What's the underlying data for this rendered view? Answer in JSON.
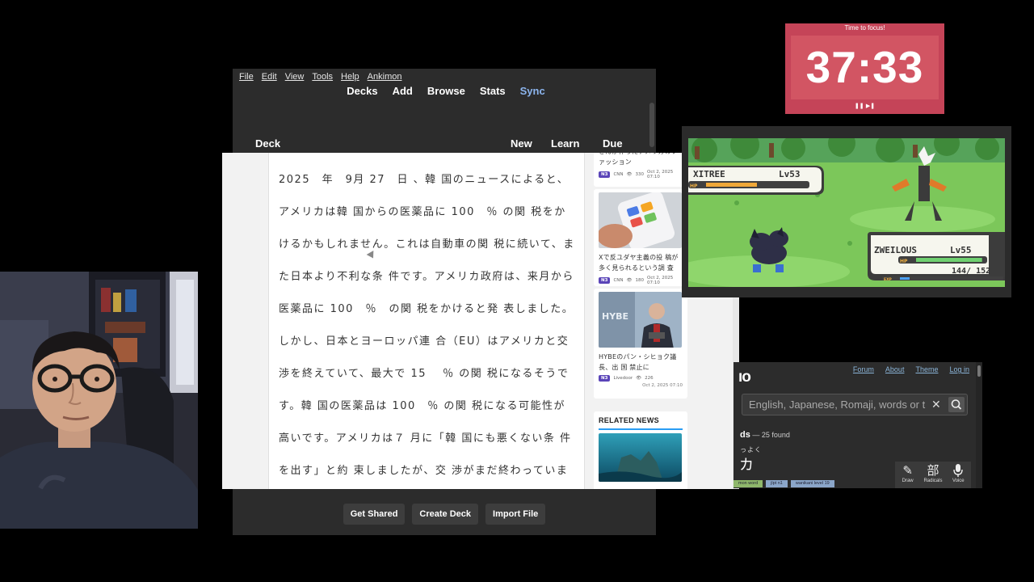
{
  "anki": {
    "menu": [
      "File",
      "Edit",
      "View",
      "Tools",
      "Help",
      "Ankimon"
    ],
    "toolbar": {
      "decks": "Decks",
      "add": "Add",
      "browse": "Browse",
      "stats": "Stats",
      "sync": "Sync"
    },
    "deck_header": {
      "deck": "Deck",
      "new": "New",
      "learn": "Learn",
      "due": "Due"
    },
    "bottom_buttons": {
      "get_shared": "Get Shared",
      "create_deck": "Create Deck",
      "import_file": "Import File"
    }
  },
  "article": {
    "body": "2025　年　9月 27　日 、韓 国のニュースによると、アメリカは韓 国からの医薬品に 100　％ の関 税をかけるかもしれません。これは自動車の関 税に続いて、また日本より不利な条 件です。アメリカ政府は、来月から医薬品に 100　％　の関 税をかけると発 表しました。しかし、日本とヨーロッパ連 合（EU）はアメリカと交 渉を終えていて、最大で 15　 ％ の関 税になるそうです。韓 国の医薬品は 100　％ の関 税になる可能性が高いです。アメリカは７ 月に「韓 国にも悪くない条 件を出す」と約 束しましたが、交 渉がまだ終わっていません。そのため、韓 国だけ高い"
  },
  "sidebar": {
    "cards": [
      {
        "title": "さんが作ったアメリカのファッション",
        "level": "N3",
        "source": "CNN",
        "views": "330",
        "date": "Oct 2, 2025 07:10"
      },
      {
        "title": "Xで反ユダヤ主義の投 稿が多く見られるという調 査",
        "level": "N3",
        "source": "CNN",
        "views": "180",
        "date": "Oct 2, 2025 07:10"
      },
      {
        "title": "HYBEのパン・シヒョク議 長、出 国 禁止に",
        "level": "N3",
        "source": "Livedoor",
        "views": "226",
        "date": "Oct 2, 2025 07:10"
      }
    ],
    "related_heading": "RELATED NEWS"
  },
  "timer": {
    "label": "Time to focus!",
    "time": "37:33",
    "controls": "❚❚ ▶❚",
    "color": "#c54458"
  },
  "game": {
    "enemy_name": "XITREE",
    "enemy_level": "Lv53",
    "enemy_hp_fraction": 0.5,
    "player_name": "ZWEILOUS",
    "player_level": "Lv55",
    "player_hp_text": "144/ 152",
    "player_hp_fraction": 0.95,
    "hp_label": "HP",
    "exp_label": "EXP"
  },
  "jisho": {
    "links": [
      "Forum",
      "About",
      "Theme",
      "Log in"
    ],
    "logo": "ıo",
    "search_placeholder": "English, Japanese, Romaji, words or t",
    "found_prefix": "ds",
    "found_text": " — 25 found",
    "furigana": "っよく",
    "word": "カ",
    "tags": [
      "mon word",
      "jlpt n1",
      "wanikani level 19"
    ],
    "tools": [
      {
        "icon": "draw-icon",
        "glyph": "✎",
        "label": "Draw"
      },
      {
        "icon": "radicals-icon",
        "glyph": "部",
        "label": "Radicals"
      },
      {
        "icon": "microphone-icon",
        "glyph": "🎤",
        "label": "Voice"
      }
    ]
  }
}
